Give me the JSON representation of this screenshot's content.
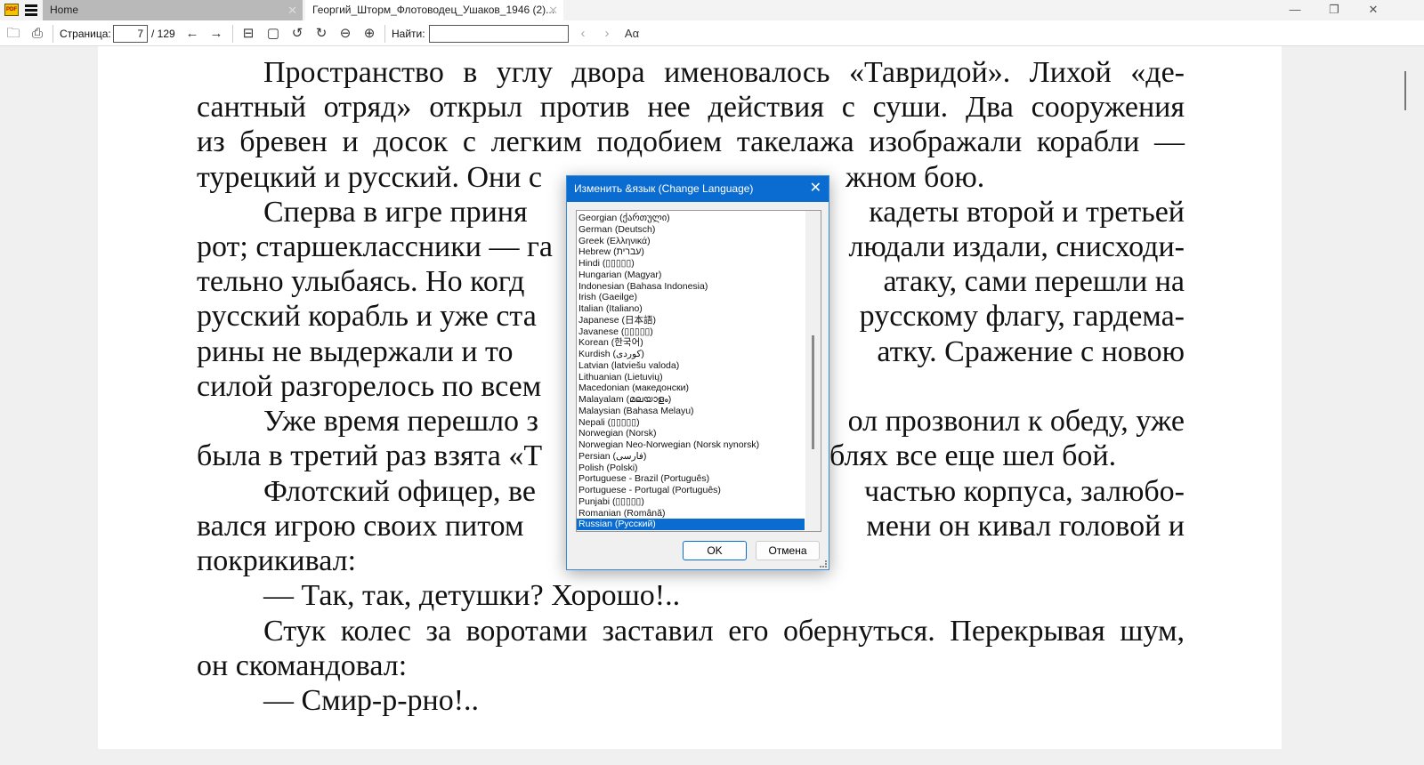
{
  "tabs": [
    {
      "label": "Home"
    },
    {
      "label": "Георгий_Шторм_Флотоводец_Ушаков_1946  (2)..."
    }
  ],
  "toolbar": {
    "page_label": "Страница:",
    "page_value": "7",
    "page_total": "/ 129",
    "find_label": "Найти:",
    "find_value": "",
    "font_icon_text": "Aα"
  },
  "document": {
    "lines": [
      "Пространство в углу двора именовалось «Тавридой». Лихой «де-",
      "сантный отряд» открыл против нее действия с суши. Два сооружения",
      "из бревен и досок с легким подобием такелажа изображали корабли —",
      "турецкий и русский. Они с",
      "жном бою.",
      "Сперва в игре приня",
      "кадеты второй и третьей",
      "рот; старшеклассники — га",
      "людали издали, снисходи-",
      "тельно улыбаясь. Но когд",
      "атаку, сами перешли на",
      "русский корабль и уже ста",
      "русскому флагу, гардема-",
      "рины не выдержали и то",
      "атку. Сражение с новою",
      "силой разгорелось по всем",
      "Уже время перешло з",
      "ол прозвонил к обеду, уже",
      "была в третий раз взята «Т",
      "блях все еще шел бой.",
      "Флотский офицер, ве",
      "частью корпуса, залюбо-",
      "вался игрою своих питом",
      "мени он кивал головой и",
      "покрикивал:",
      "— Так, так, детушки? Хорошо!..",
      "Стук колес за воротами заставил его обернуться. Перекрывая шум,",
      "он скомандовал:",
      "— Смир-р-рно!.."
    ]
  },
  "dialog": {
    "title": "Изменить &язык (Change Language)",
    "ok": "OK",
    "cancel": "Отмена",
    "selected": "Russian (Русский)",
    "languages": [
      "Georgian (ქართული)",
      "German (Deutsch)",
      "Greek (Ελληνικά)",
      "Hebrew (עברית)",
      "Hindi (▯▯▯▯▯)",
      "Hungarian (Magyar)",
      "Indonesian (Bahasa Indonesia)",
      "Irish (Gaeilge)",
      "Italian (Italiano)",
      "Japanese (日本語)",
      "Javanese (▯▯▯▯▯)",
      "Korean (한국어)",
      "Kurdish (كوردی)",
      "Latvian (latviešu valoda)",
      "Lithuanian (Lietuvių)",
      "Macedonian (македонски)",
      "Malayalam (മലയാളം)",
      "Malaysian (Bahasa Melayu)",
      "Nepali (▯▯▯▯▯)",
      "Norwegian (Norsk)",
      "Norwegian Neo-Norwegian (Norsk nynorsk)",
      "Persian (فارسی)",
      "Polish (Polski)",
      "Portuguese - Brazil (Português)",
      "Portuguese - Portugal (Português)",
      "Punjabi (▯▯▯▯▯)",
      "Romanian (Română)",
      "Russian (Русский)"
    ]
  },
  "colors": {
    "accent": "#0a6cd0"
  }
}
